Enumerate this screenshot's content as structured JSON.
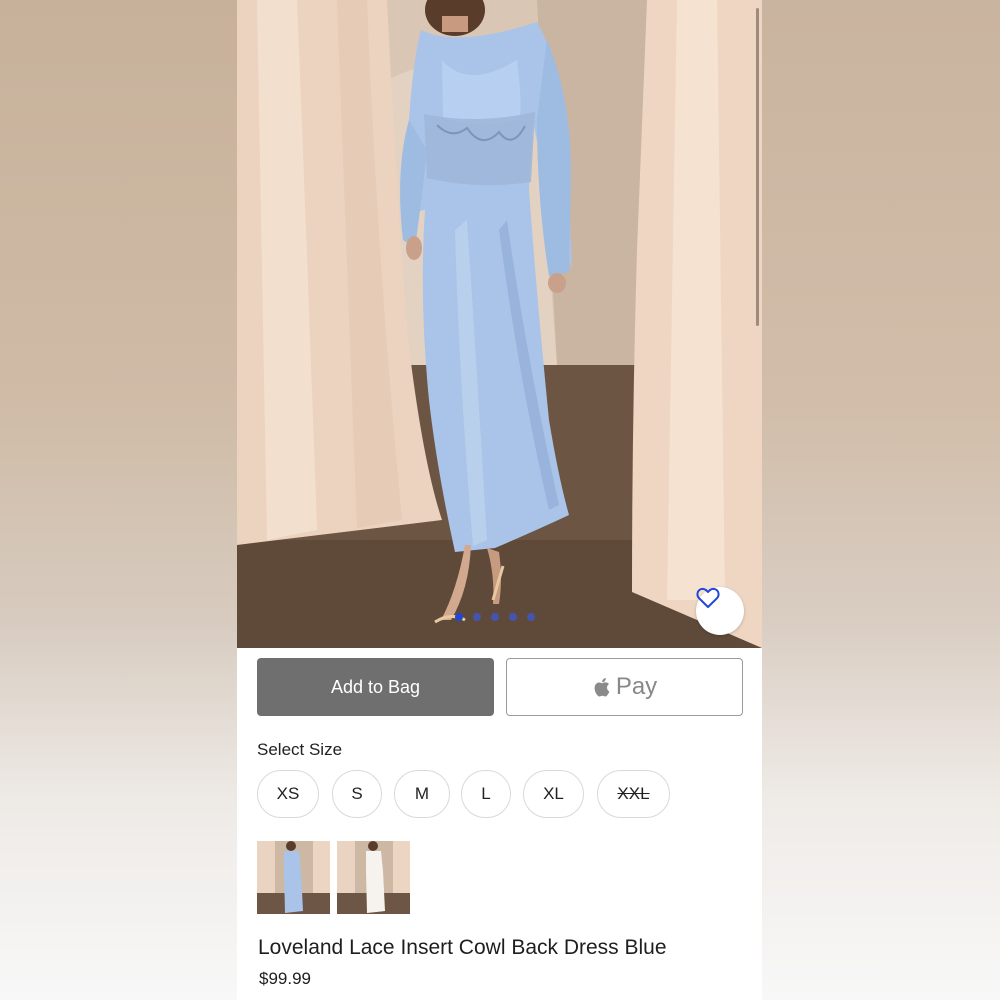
{
  "gallery": {
    "dot_count": 5,
    "active_index": 0,
    "accent_color": "#2146d8"
  },
  "actions": {
    "add_to_bag_label": "Add to Bag",
    "apple_pay_label": "Pay",
    "apple_pay_icon": "apple-logo-icon",
    "favorite_icon": "heart-outline-icon"
  },
  "size_picker": {
    "label": "Select Size",
    "options": [
      {
        "label": "XS",
        "available": true
      },
      {
        "label": "S",
        "available": true
      },
      {
        "label": "M",
        "available": true
      },
      {
        "label": "L",
        "available": true
      },
      {
        "label": "XL",
        "available": true
      },
      {
        "label": "XXL",
        "available": false
      }
    ]
  },
  "color_swatches": [
    {
      "color_name": "Blue",
      "selected": true
    },
    {
      "color_name": "White",
      "selected": false
    }
  ],
  "product": {
    "title": "Loveland Lace Insert Cowl Back Dress Blue",
    "price": "$99.99"
  }
}
